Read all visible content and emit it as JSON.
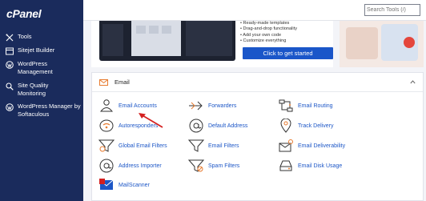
{
  "sidebar": {
    "logo": "cPanel",
    "items": [
      {
        "label": "Tools"
      },
      {
        "label": "Sitejet Builder"
      },
      {
        "label": "WordPress Management"
      },
      {
        "label": "Site Quality Monitoring"
      },
      {
        "label": "WordPress Manager by Softaculous"
      }
    ]
  },
  "topbar": {
    "search_placeholder": "Search Tools (/)"
  },
  "promo": {
    "bullets": [
      "Ready-made templates",
      "Drag-and-drop functionality",
      "Add your own code",
      "Customize everything"
    ],
    "cta_label": "Click to get started"
  },
  "email": {
    "title": "Email",
    "items": [
      {
        "label": "Email Accounts",
        "icon": "user-icon"
      },
      {
        "label": "Forwarders",
        "icon": "forward-arrow-icon"
      },
      {
        "label": "Email Routing",
        "icon": "routing-icon"
      },
      {
        "label": "Autoresponders",
        "icon": "autoresponder-icon"
      },
      {
        "label": "Default Address",
        "icon": "at-sign-icon"
      },
      {
        "label": "Track Delivery",
        "icon": "map-pin-icon"
      },
      {
        "label": "Global Email Filters",
        "icon": "globe-filter-icon"
      },
      {
        "label": "Email Filters",
        "icon": "filter-icon"
      },
      {
        "label": "Email Deliverability",
        "icon": "key-deliverability-icon"
      },
      {
        "label": "Address Importer",
        "icon": "at-import-icon"
      },
      {
        "label": "Spam Filters",
        "icon": "spam-filter-icon"
      },
      {
        "label": "Email Disk Usage",
        "icon": "disk-icon"
      },
      {
        "label": "MailScanner",
        "icon": "mailscanner-icon"
      }
    ]
  },
  "colors": {
    "sidebar_bg": "#1a2b5c",
    "link": "#1d57c7",
    "accent_orange": "#e77b2f",
    "cta_blue": "#1a56c9",
    "arrow_red": "#d42020"
  }
}
